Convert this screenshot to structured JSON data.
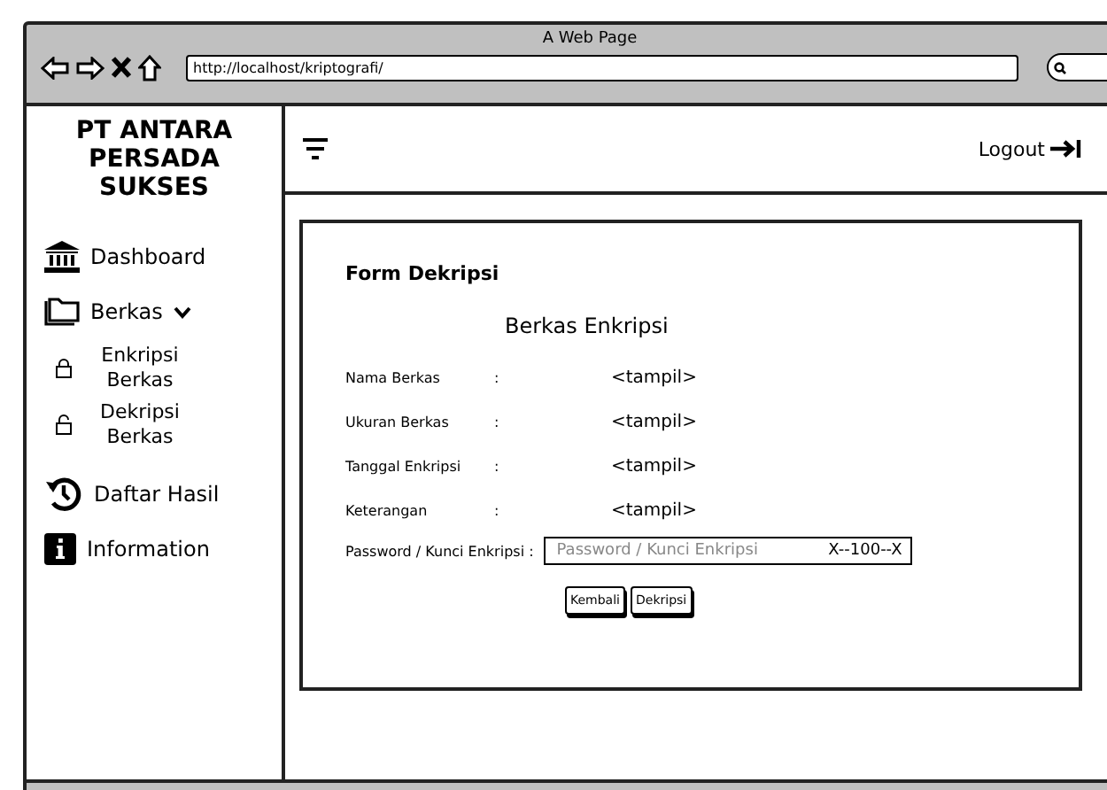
{
  "window": {
    "title": "A Web Page",
    "url": "http://localhost/kriptografi/"
  },
  "sidebar": {
    "brand": "PT ANTARA PERSADA SUKSES",
    "items": [
      {
        "kind": "bank",
        "label": "Dashboard"
      },
      {
        "kind": "folder",
        "label": "Berkas",
        "expanded": true,
        "children": [
          {
            "kind": "lock",
            "label": "Enkripsi Berkas"
          },
          {
            "kind": "unlock",
            "label": "Dekripsi Berkas"
          }
        ]
      },
      {
        "kind": "history",
        "label": "Daftar Hasil"
      },
      {
        "kind": "info",
        "label": "Information"
      }
    ]
  },
  "header": {
    "logout": "Logout"
  },
  "form": {
    "title": "Form Dekripsi",
    "subtitle": "Berkas Enkripsi",
    "fields": [
      {
        "label": "Nama Berkas",
        "colon": ":",
        "value": "<tampil>"
      },
      {
        "label": "Ukuran Berkas",
        "colon": ":",
        "value": "<tampil>"
      },
      {
        "label": "Tanggal Enkripsi",
        "colon": ":",
        "value": "<tampil>"
      },
      {
        "label": "Keterangan",
        "colon": ":",
        "value": "<tampil>"
      }
    ],
    "password": {
      "label": "Password / Kunci Enkripsi :",
      "placeholder": "Password / Kunci Enkripsi",
      "max": "X--100--X"
    },
    "buttons": [
      "Kembali",
      "Dekripsi"
    ]
  }
}
